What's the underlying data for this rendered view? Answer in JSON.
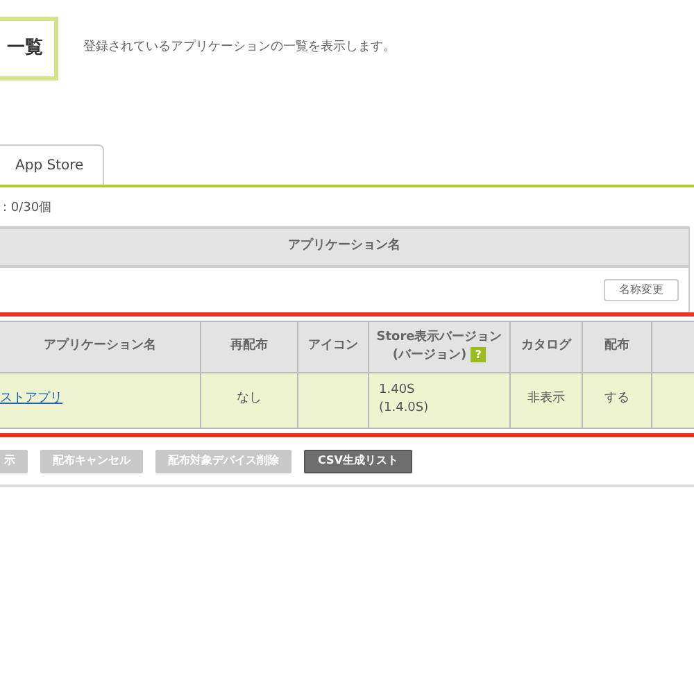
{
  "header": {
    "title": "一覧",
    "description": "登録されているアプリケーションの一覧を表示します。"
  },
  "tabs": [
    {
      "label": "App Store",
      "selected": true
    }
  ],
  "count": ": 0/30個",
  "name_table": {
    "column": "アプリケーション名",
    "button": "名称変更"
  },
  "app_table": {
    "columns": [
      "アプリケーション名",
      "再配布",
      "アイコン",
      "Store表示バージョン\n(バージョン)",
      "カタログ",
      "配布"
    ],
    "help_mark": "?",
    "rows": [
      {
        "selected": true,
        "name": "ストアプリ",
        "redistribute": "なし",
        "version": "1.40S\n(1.4.0S)",
        "catalog": "非表示",
        "distribute": "する"
      }
    ]
  },
  "buttons": [
    {
      "label": "示",
      "disabled": true
    },
    {
      "label": "配布キャンセル",
      "disabled": true
    },
    {
      "label": "配布対象デバイス削除",
      "disabled": true
    },
    {
      "label": "CSV生成リスト",
      "disabled": false
    }
  ]
}
